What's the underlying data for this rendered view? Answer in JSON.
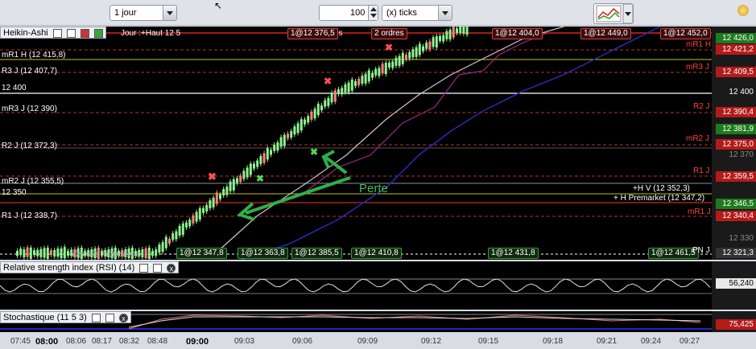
{
  "toolbar": {
    "period": "1 jour",
    "quantity": "100",
    "unit": "(x) ticks"
  },
  "main_panel": {
    "title": "Heikin-Ashi",
    "info_text": "Jour :+Haut 12 5",
    "info_text2": "ds",
    "bottom_label": "Densité indicatives",
    "annotation": "Perte",
    "left_levels": [
      {
        "label": "mR1 H (12 415,8)"
      },
      {
        "label": "R3 J (12 407,7)"
      },
      {
        "label": "12 400"
      },
      {
        "label": "mR3 J (12 390)"
      },
      {
        "label": "R2 J (12 372,3)"
      },
      {
        "label": "mR2 J (12 355,5)"
      },
      {
        "label": "12 350"
      },
      {
        "label": "R1 J (12 338,7)"
      }
    ],
    "right_labels": [
      {
        "name": "mR1 H"
      },
      {
        "name": "mR3 J"
      },
      {
        "name": "R2 J"
      },
      {
        "name": "mR2 J"
      },
      {
        "name": "R1 J"
      },
      {
        "name": "+H V (12 352,3)"
      },
      {
        "name": "+ H Premarket (12 347,2)"
      },
      {
        "name": "mR1 J"
      },
      {
        "name": "PN J"
      }
    ],
    "price_axis": [
      {
        "text": "12 426,0",
        "color": "#1f7a1f"
      },
      {
        "text": "12 421,2",
        "color": "#b31b1b"
      },
      {
        "text": "12 409,5",
        "color": "#b31b1b"
      },
      {
        "text": "12 400",
        "color": "none"
      },
      {
        "text": "12 390,4",
        "color": "#b31b1b"
      },
      {
        "text": "12 381,9",
        "color": "#1f7a1f"
      },
      {
        "text": "12 375,0",
        "color": "#b31b1b"
      },
      {
        "text": "12 370",
        "color": "none"
      },
      {
        "text": "12 359,5",
        "color": "#b31b1b"
      },
      {
        "text": "12 346,5",
        "color": "#1f7a1f"
      },
      {
        "text": "12 340,4",
        "color": "#b31b1b"
      },
      {
        "text": "12 330",
        "color": "none"
      },
      {
        "text": "12 321,3",
        "color": "#333333"
      }
    ],
    "top_tags": [
      "1@12 376,5",
      "2 ordres",
      "1@12 404,0",
      "1@12 449,0",
      "1@12 452,0"
    ],
    "bottom_tags": [
      "1@12 347,8",
      "1@12 363,8",
      "1@12 385,5",
      "1@12 410,8",
      "1@12 431,8",
      "1@12 461,5"
    ]
  },
  "rsi_panel": {
    "title": "Relative strength index (RSI) (14)",
    "value": "56,240"
  },
  "stoch_panel": {
    "title": "Stochastique (11 5 3)",
    "value": "75,425"
  },
  "time_axis": [
    {
      "t": "07:45",
      "bold": false
    },
    {
      "t": "08:00",
      "bold": true
    },
    {
      "t": "08:06",
      "bold": false
    },
    {
      "t": "08:17",
      "bold": false
    },
    {
      "t": "08:32",
      "bold": false
    },
    {
      "t": "08:48",
      "bold": false
    },
    {
      "t": "09:00",
      "bold": true
    },
    {
      "t": "09:03",
      "bold": false
    },
    {
      "t": "09:06",
      "bold": false
    },
    {
      "t": "09:09",
      "bold": false
    },
    {
      "t": "09:12",
      "bold": false
    },
    {
      "t": "09:15",
      "bold": false
    },
    {
      "t": "09:18",
      "bold": false
    },
    {
      "t": "09:21",
      "bold": false
    },
    {
      "t": "09:24",
      "bold": false
    },
    {
      "t": "09:27",
      "bold": false
    }
  ]
}
